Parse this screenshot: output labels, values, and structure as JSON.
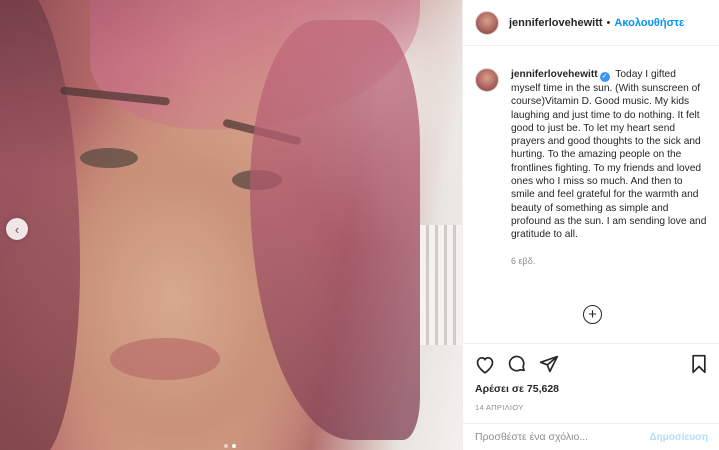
{
  "post": {
    "username": "jenniferlovehewitt",
    "separator": "•",
    "follow_label": "Ακολουθήστε",
    "verified_icon": "✓",
    "caption": "Today I gifted myself time in the sun. (With sunscreen of course)Vitamin D. Good music. My kids laughing and just time to do nothing. It felt good to just be. To let my heart send prayers and good thoughts to the sick and hurting. To the amazing people on the frontlines fighting. To my friends and loved ones who I miss so much. And then to smile and feel grateful for the warmth and beauty of something as simple and profound as the sun. I am sending love and gratitude to all.",
    "time_ago": "6 εβδ.",
    "likes": "Αρέσει σε 75,628",
    "date": "14 ΑΠΡΙΛΙΟΥ"
  },
  "comment": {
    "placeholder": "Προσθέστε ένα σχόλιο...",
    "post_label": "Δημοσίευση"
  },
  "carousel": {
    "prev_icon": "‹",
    "slide_count": 2,
    "active_slide": 2
  },
  "icons": {
    "like": "heart-icon",
    "comment": "comment-icon",
    "share": "paper-plane-icon",
    "save": "bookmark-icon",
    "load_more": "plus-circle-icon"
  },
  "colors": {
    "accent": "#0095f6",
    "verified": "#3897f0",
    "muted": "#8e8e8e"
  }
}
